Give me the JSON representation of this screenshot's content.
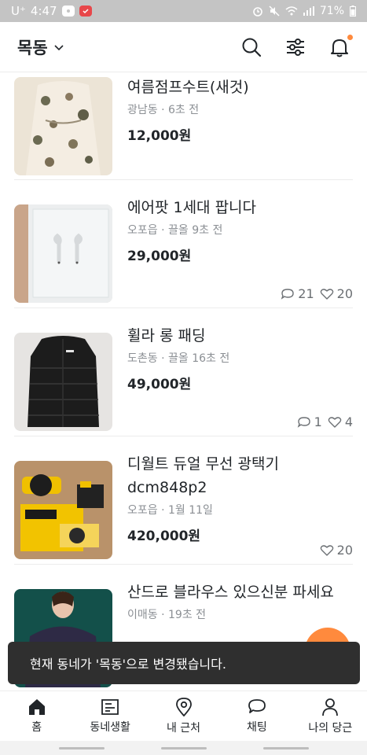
{
  "status_bar": {
    "carrier": "U⁺",
    "time": "4:47",
    "battery": "71%"
  },
  "header": {
    "location": "목동"
  },
  "items": [
    {
      "title": "여름점프수트(새것)",
      "location": "광남동",
      "time": "6초 전",
      "price": "12,000원"
    },
    {
      "title": "에어팟 1세대 팝니다",
      "location": "오포읍",
      "time": "끌올 9초 전",
      "price": "29,000원",
      "chats": "21",
      "likes": "20"
    },
    {
      "title": "휠라 롱 패딩",
      "location": "도촌동",
      "time": "끌올 16초 전",
      "price": "49,000원",
      "chats": "1",
      "likes": "4"
    },
    {
      "title_line1": "디월트 듀얼 무선 광택기",
      "title_line2": "dcm848p2",
      "location": "오포읍",
      "time": "1월 11일",
      "price": "420,000원",
      "likes": "20"
    },
    {
      "title": "산드로 블라우스 있으신분 파세요",
      "location": "이매동",
      "time": "19초 전"
    }
  ],
  "meta_separator": "·",
  "toast": "현재 동네가 '목동'으로 변경됐습니다.",
  "bottom_nav": [
    {
      "label": "홈",
      "icon": "home-icon"
    },
    {
      "label": "동네생활",
      "icon": "community-icon"
    },
    {
      "label": "내 근처",
      "icon": "location-pin-icon"
    },
    {
      "label": "채팅",
      "icon": "chat-icon"
    },
    {
      "label": "나의 당근",
      "icon": "person-icon"
    }
  ],
  "colors": {
    "accent": "#ff8a3d",
    "text": "#212529",
    "muted": "#8b8f94",
    "toast_bg": "#2f2f2f"
  }
}
